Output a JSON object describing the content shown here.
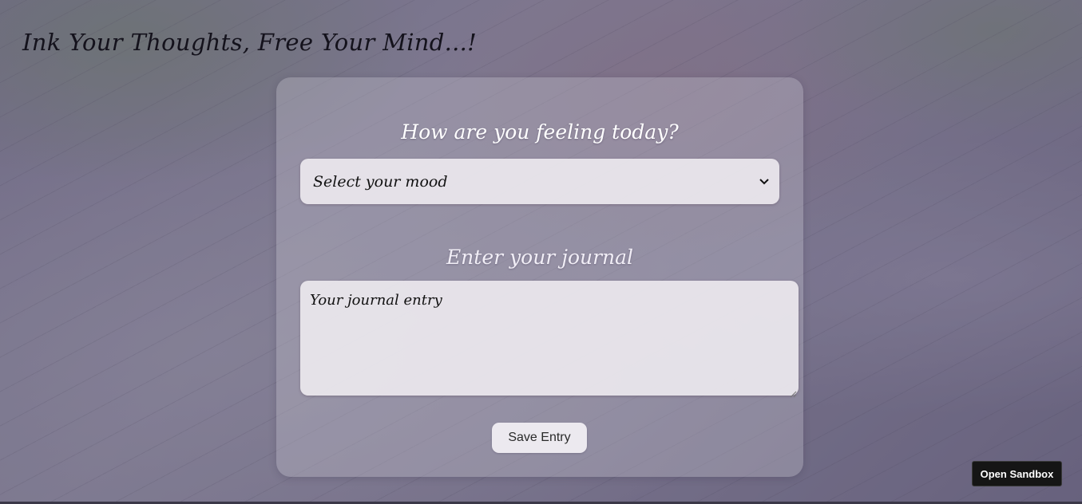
{
  "header": {
    "title": "Ink Your Thoughts, Free Your Mind...!"
  },
  "form": {
    "mood_label": "How are you feeling today?",
    "mood_select": {
      "selected": "Select your mood"
    },
    "journal_label": "Enter your journal",
    "journal_input": {
      "placeholder": "Your journal entry",
      "value": ""
    },
    "save_label": "Save Entry"
  },
  "sandbox": {
    "button_label": "Open Sandbox"
  },
  "icons": {
    "select_arrow": "chevron-down-icon",
    "resize_handle": "resize-grip-icon"
  },
  "colors": {
    "title_text": "#14121c",
    "label_text": "#ffffff",
    "field_background": "#ece8ee",
    "button_background": "#ece9ef",
    "sandbox_button_background": "#151515"
  }
}
